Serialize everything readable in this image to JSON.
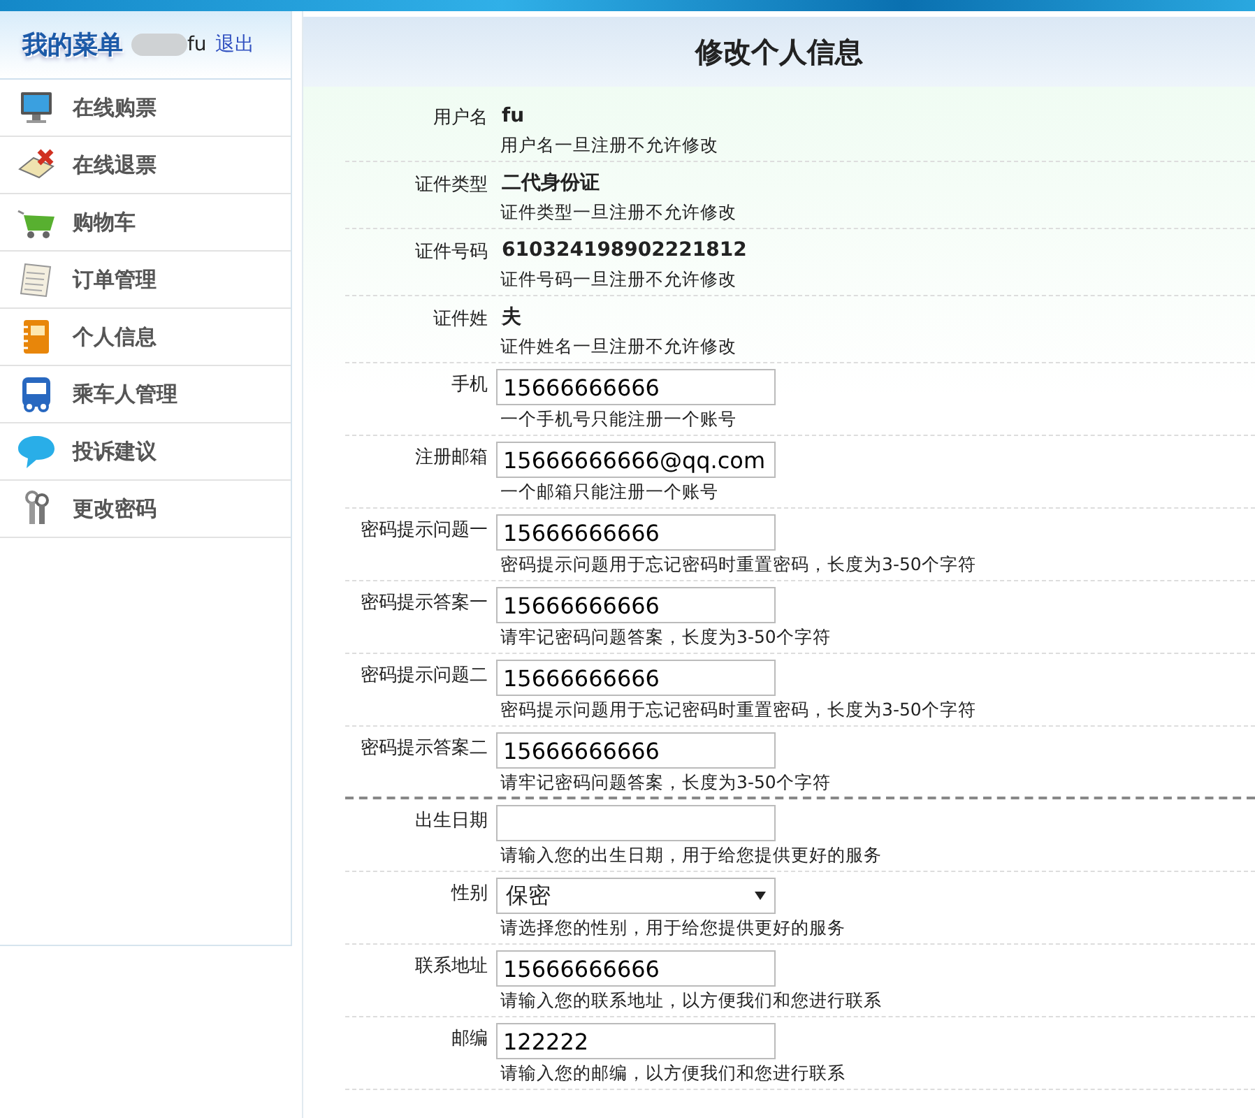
{
  "sidebar": {
    "title": "我的菜单",
    "user": "fu",
    "logout": "退出",
    "items": [
      {
        "label": "在线购票"
      },
      {
        "label": "在线退票"
      },
      {
        "label": "购物车"
      },
      {
        "label": "订单管理"
      },
      {
        "label": "个人信息"
      },
      {
        "label": "乘车人管理"
      },
      {
        "label": "投诉建议"
      },
      {
        "label": "更改密码"
      }
    ]
  },
  "form": {
    "title": "修改个人信息",
    "rows": [
      {
        "kind": "text",
        "label": "用户名",
        "value": "fu",
        "hint": "用户名一旦注册不允许修改"
      },
      {
        "kind": "text",
        "label": "证件类型",
        "value": "二代身份证",
        "hint": "证件类型一旦注册不允许修改"
      },
      {
        "kind": "text",
        "label": "证件号码",
        "value": "610324198902221812",
        "hint": "证件号码一旦注册不允许修改"
      },
      {
        "kind": "text",
        "label": "证件姓",
        "value": "夫",
        "hint": "证件姓名一旦注册不允许修改"
      },
      {
        "kind": "input",
        "label": "手机",
        "value": "15666666666",
        "hint": "一个手机号只能注册一个账号"
      },
      {
        "kind": "input",
        "label": "注册邮箱",
        "value": "15666666666@qq.com",
        "hint": "一个邮箱只能注册一个账号"
      },
      {
        "kind": "input",
        "label": "密码提示问题一",
        "value": "15666666666",
        "hint": "密码提示问题用于忘记密码时重置密码，长度为3-50个字符"
      },
      {
        "kind": "input",
        "label": "密码提示答案一",
        "value": "15666666666",
        "hint": "请牢记密码问题答案，长度为3-50个字符"
      },
      {
        "kind": "input",
        "label": "密码提示问题二",
        "value": "15666666666",
        "hint": "密码提示问题用于忘记密码时重置密码，长度为3-50个字符"
      },
      {
        "kind": "input",
        "label": "密码提示答案二",
        "value": "15666666666",
        "hint": "请牢记密码问题答案，长度为3-50个字符",
        "section_end": true
      },
      {
        "kind": "input",
        "label": "出生日期",
        "hint": "请输入您的出生日期，用于给您提供更好的服务"
      },
      {
        "kind": "select",
        "label": "性别",
        "value": "保密",
        "hint": "请选择您的性别，用于给您提供更好的服务"
      },
      {
        "kind": "input",
        "label": "联系地址",
        "value": "15666666666",
        "hint": "请输入您的联系地址，以方便我们和您进行联系"
      },
      {
        "kind": "input",
        "label": "邮编",
        "value": "122222",
        "hint": "请输入您的邮编，以方便我们和您进行联系"
      }
    ]
  }
}
